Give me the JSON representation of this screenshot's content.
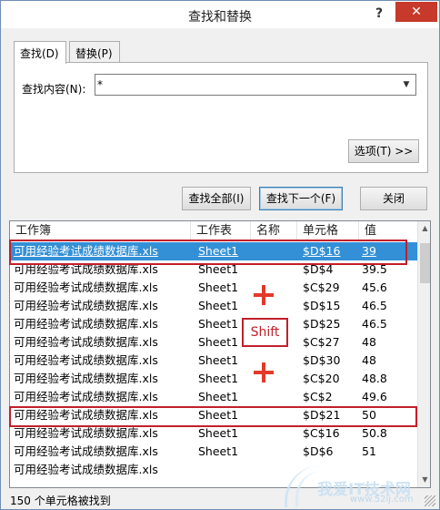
{
  "dialog": {
    "title": "查找和替换",
    "help_label": "?",
    "close_label": "✕"
  },
  "tabs": [
    {
      "label": "查找(D)",
      "active": true
    },
    {
      "label": "替换(P)",
      "active": false
    }
  ],
  "find": {
    "label": "查找内容(N):",
    "value": "*"
  },
  "buttons": {
    "options": "选项(T) >>",
    "find_all": "查找全部(I)",
    "find_next": "查找下一个(F)",
    "close": "关闭"
  },
  "results": {
    "columns": [
      "工作簿",
      "工作表",
      "名称",
      "单元格",
      "值"
    ],
    "rows": [
      {
        "book": "可用经验考试成绩数据库.xls",
        "sheet": "Sheet1",
        "name": "",
        "cell": "$D$16",
        "value": "39"
      },
      {
        "book": "可用经验考试成绩数据库.xls",
        "sheet": "Sheet1",
        "name": "",
        "cell": "$D$4",
        "value": "39.5"
      },
      {
        "book": "可用经验考试成绩数据库.xls",
        "sheet": "Sheet1",
        "name": "",
        "cell": "$C$29",
        "value": "45.6"
      },
      {
        "book": "可用经验考试成绩数据库.xls",
        "sheet": "Sheet1",
        "name": "",
        "cell": "$D$15",
        "value": "46.5"
      },
      {
        "book": "可用经验考试成绩数据库.xls",
        "sheet": "Sheet1",
        "name": "",
        "cell": "$D$25",
        "value": "46.5"
      },
      {
        "book": "可用经验考试成绩数据库.xls",
        "sheet": "Sheet1",
        "name": "",
        "cell": "$C$27",
        "value": "48"
      },
      {
        "book": "可用经验考试成绩数据库.xls",
        "sheet": "Sheet1",
        "name": "",
        "cell": "$D$30",
        "value": "48"
      },
      {
        "book": "可用经验考试成绩数据库.xls",
        "sheet": "Sheet1",
        "name": "",
        "cell": "$C$20",
        "value": "48.8"
      },
      {
        "book": "可用经验考试成绩数据库.xls",
        "sheet": "Sheet1",
        "name": "",
        "cell": "$C$2",
        "value": "49.6"
      },
      {
        "book": "可用经验考试成绩数据库.xls",
        "sheet": "Sheet1",
        "name": "",
        "cell": "$D$21",
        "value": "50"
      },
      {
        "book": "可用经验考试成绩数据库.xls",
        "sheet": "Sheet1",
        "name": "",
        "cell": "$C$16",
        "value": "50.8"
      },
      {
        "book": "可用经验考试成绩数据库.xls",
        "sheet": "Sheet1",
        "name": "",
        "cell": "$D$6",
        "value": "51"
      },
      {
        "book": "可用经验考试成绩数据库.xls",
        "sheet": "",
        "name": "",
        "cell": "",
        "value": ""
      }
    ],
    "selected_index": 0
  },
  "status": "150 个单元格被找到",
  "annotations": {
    "shift_label": "Shift"
  },
  "watermark": {
    "text": "我爱IT技术网",
    "url": "www.52ij.com"
  },
  "colors": {
    "selection": "#3390d6",
    "annotation_red": "#c21f2b",
    "plus_red": "#e23a2a",
    "close_button": "#c7392b"
  },
  "icons": {
    "help": "question-mark-icon",
    "close": "close-icon",
    "dropdown": "chevron-down-icon",
    "scroll_up": "scroll-up-arrow-icon",
    "scroll_down": "scroll-down-arrow-icon",
    "plus": "plus-icon",
    "grip": "resize-grip-icon"
  }
}
